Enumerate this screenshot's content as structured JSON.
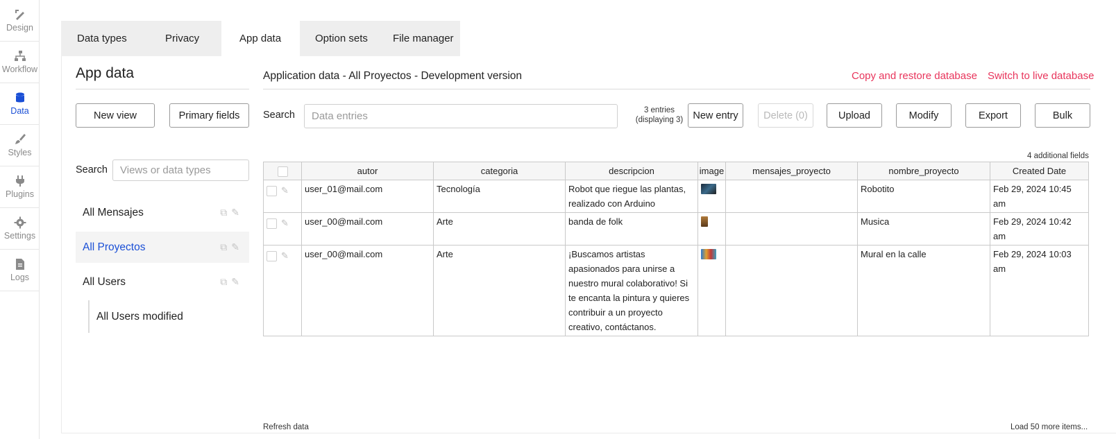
{
  "rail": [
    {
      "label": "Design",
      "icon": "design-icon"
    },
    {
      "label": "Workflow",
      "icon": "workflow-icon"
    },
    {
      "label": "Data",
      "icon": "database-icon",
      "active": true
    },
    {
      "label": "Styles",
      "icon": "brush-icon"
    },
    {
      "label": "Plugins",
      "icon": "plug-icon"
    },
    {
      "label": "Settings",
      "icon": "gear-icon"
    },
    {
      "label": "Logs",
      "icon": "document-icon"
    }
  ],
  "tabs": [
    {
      "label": "Data types"
    },
    {
      "label": "Privacy"
    },
    {
      "label": "App data",
      "active": true
    },
    {
      "label": "Option sets"
    },
    {
      "label": "File manager"
    }
  ],
  "left": {
    "title": "App data",
    "new_view": "New view",
    "primary_fields": "Primary fields",
    "search_label": "Search",
    "search_placeholder": "Views or data types",
    "views": [
      {
        "label": "All Mensajes"
      },
      {
        "label": "All Proyectos",
        "active": true
      },
      {
        "label": "All Users"
      }
    ],
    "sub_view": "All Users modified"
  },
  "main": {
    "title": "Application data - All Proyectos - Development version",
    "copy_restore": "Copy and restore database",
    "switch_live": "Switch to live database",
    "search_label": "Search",
    "search_placeholder": "Data entries",
    "entries_count": "3 entries (displaying 3)",
    "buttons": {
      "new_entry": "New entry",
      "delete": "Delete (0)",
      "upload": "Upload",
      "modify": "Modify",
      "export": "Export",
      "bulk": "Bulk"
    },
    "additional_fields": "4 additional fields",
    "refresh": "Refresh data",
    "load_more": "Load 50 more items..."
  },
  "table": {
    "columns": [
      "autor",
      "categoria",
      "descripcion",
      "image",
      "mensajes_proyecto",
      "nombre_proyecto",
      "Created Date"
    ],
    "rows": [
      {
        "autor": "user_01@mail.com",
        "categoria": "Tecnología",
        "descripcion": "Robot que riegue las plantas, realizado con Arduino",
        "image": "robot-thumbnail",
        "mensajes_proyecto": "",
        "nombre_proyecto": "Robotito",
        "created": "Feb 29, 2024 10:45 am"
      },
      {
        "autor": "user_00@mail.com",
        "categoria": "Arte",
        "descripcion": "banda de folk",
        "image": "folk-thumbnail",
        "mensajes_proyecto": "",
        "nombre_proyecto": "Musica",
        "created": "Feb 29, 2024 10:42 am"
      },
      {
        "autor": "user_00@mail.com",
        "categoria": "Arte",
        "descripcion": "¡Buscamos artistas apasionados para unirse a nuestro mural colaborativo! Si te encanta la pintura y quieres contribuir a un proyecto creativo, contáctanos.",
        "image": "mural-thumbnail",
        "mensajes_proyecto": "",
        "nombre_proyecto": "Mural en la calle",
        "created": "Feb 29, 2024 10:03 am"
      }
    ]
  },
  "colors": {
    "accent": "#1a4fd6",
    "link": "#e8345b"
  }
}
